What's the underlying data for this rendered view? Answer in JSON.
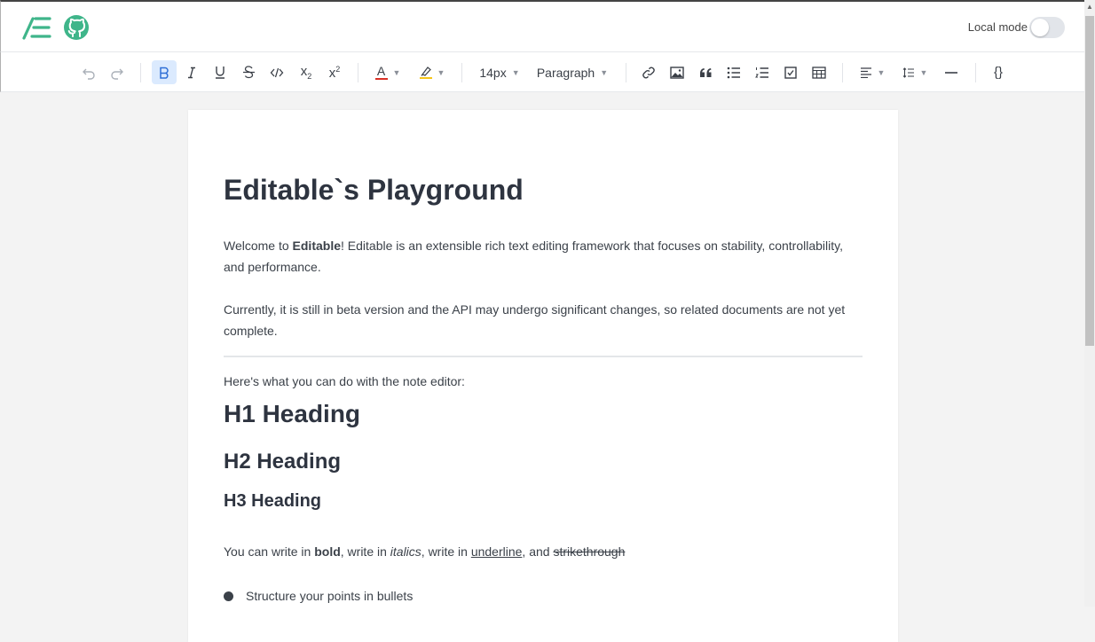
{
  "header": {
    "logo_icon": "editable-logo-icon",
    "github_icon": "github-icon",
    "local_mode_label": "Local mode",
    "local_mode_on": false,
    "brand_color": "#3fb58a"
  },
  "toolbar": {
    "font_size": "14px",
    "block_type": "Paragraph",
    "subscript_label": "x",
    "subscript_mark": "2",
    "superscript_label": "x",
    "superscript_mark": "2",
    "code_block_label": "{}",
    "font_color_letter": "A",
    "font_color": "#d93025",
    "highlight_color": "#f5c518",
    "active_color": "#2f6fd6"
  },
  "document": {
    "title": "Editable`s Playground",
    "intro_prefix": "Welcome to ",
    "intro_bold": "Editable",
    "intro_rest": "! Editable is an extensible rich text editing framework that focuses on stability, controllability, and performance.",
    "beta_note": "Currently, it is still in beta version and the API may undergo significant changes, so related documents are not yet complete.",
    "lead_in": "Here's what you can do with the note editor:",
    "h1": "H1 Heading",
    "h2": "H2 Heading",
    "h3": "H3 Heading",
    "fmt": {
      "p1": "You can write in ",
      "bold": "bold",
      "p2": ", write in ",
      "italics": "italics",
      "p3": ", write in ",
      "underline": "underline",
      "p4": ", and ",
      "strike": "strikethrough"
    },
    "bullet_1": "Structure your points in bullets"
  }
}
